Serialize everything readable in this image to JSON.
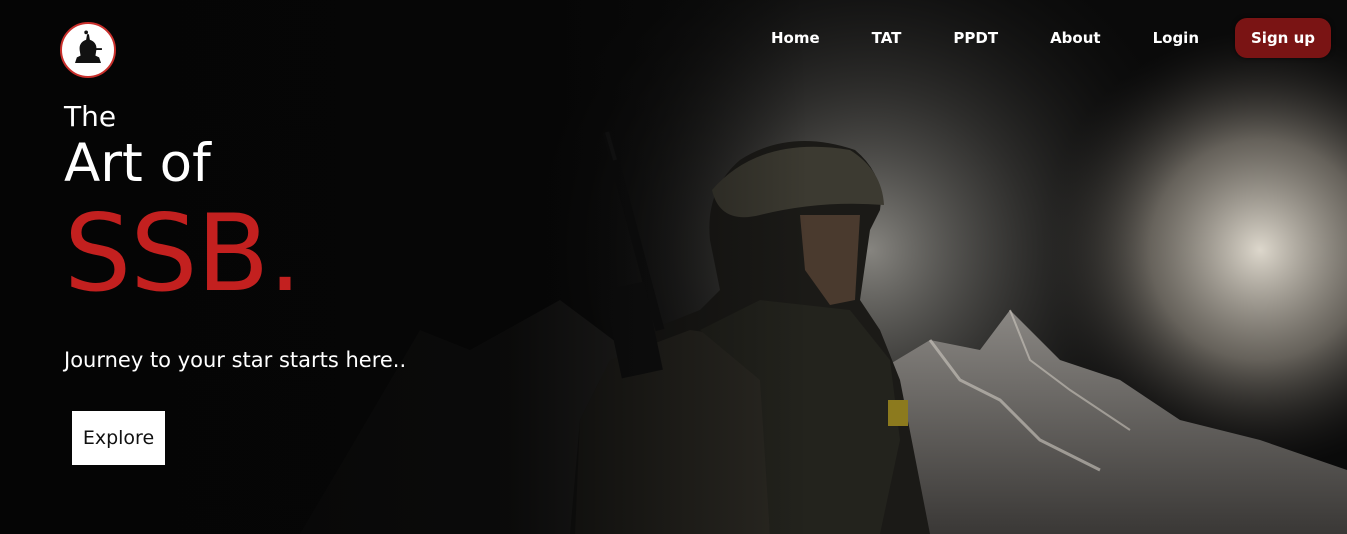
{
  "brand": {
    "logo_icon": "soldier-emblem-icon",
    "accent_color": "#c3201f",
    "button_color": "#7a1414"
  },
  "nav": {
    "items": [
      {
        "label": "Home"
      },
      {
        "label": "TAT"
      },
      {
        "label": "PPDT"
      },
      {
        "label": "About"
      },
      {
        "label": "Login"
      }
    ],
    "signup_label": "Sign up"
  },
  "hero": {
    "line1": "The",
    "line2": "Art of",
    "line3": "SSB.",
    "tagline": "Journey to your star starts here..",
    "cta_label": "Explore",
    "background_image": "soldier-mountains-image"
  }
}
